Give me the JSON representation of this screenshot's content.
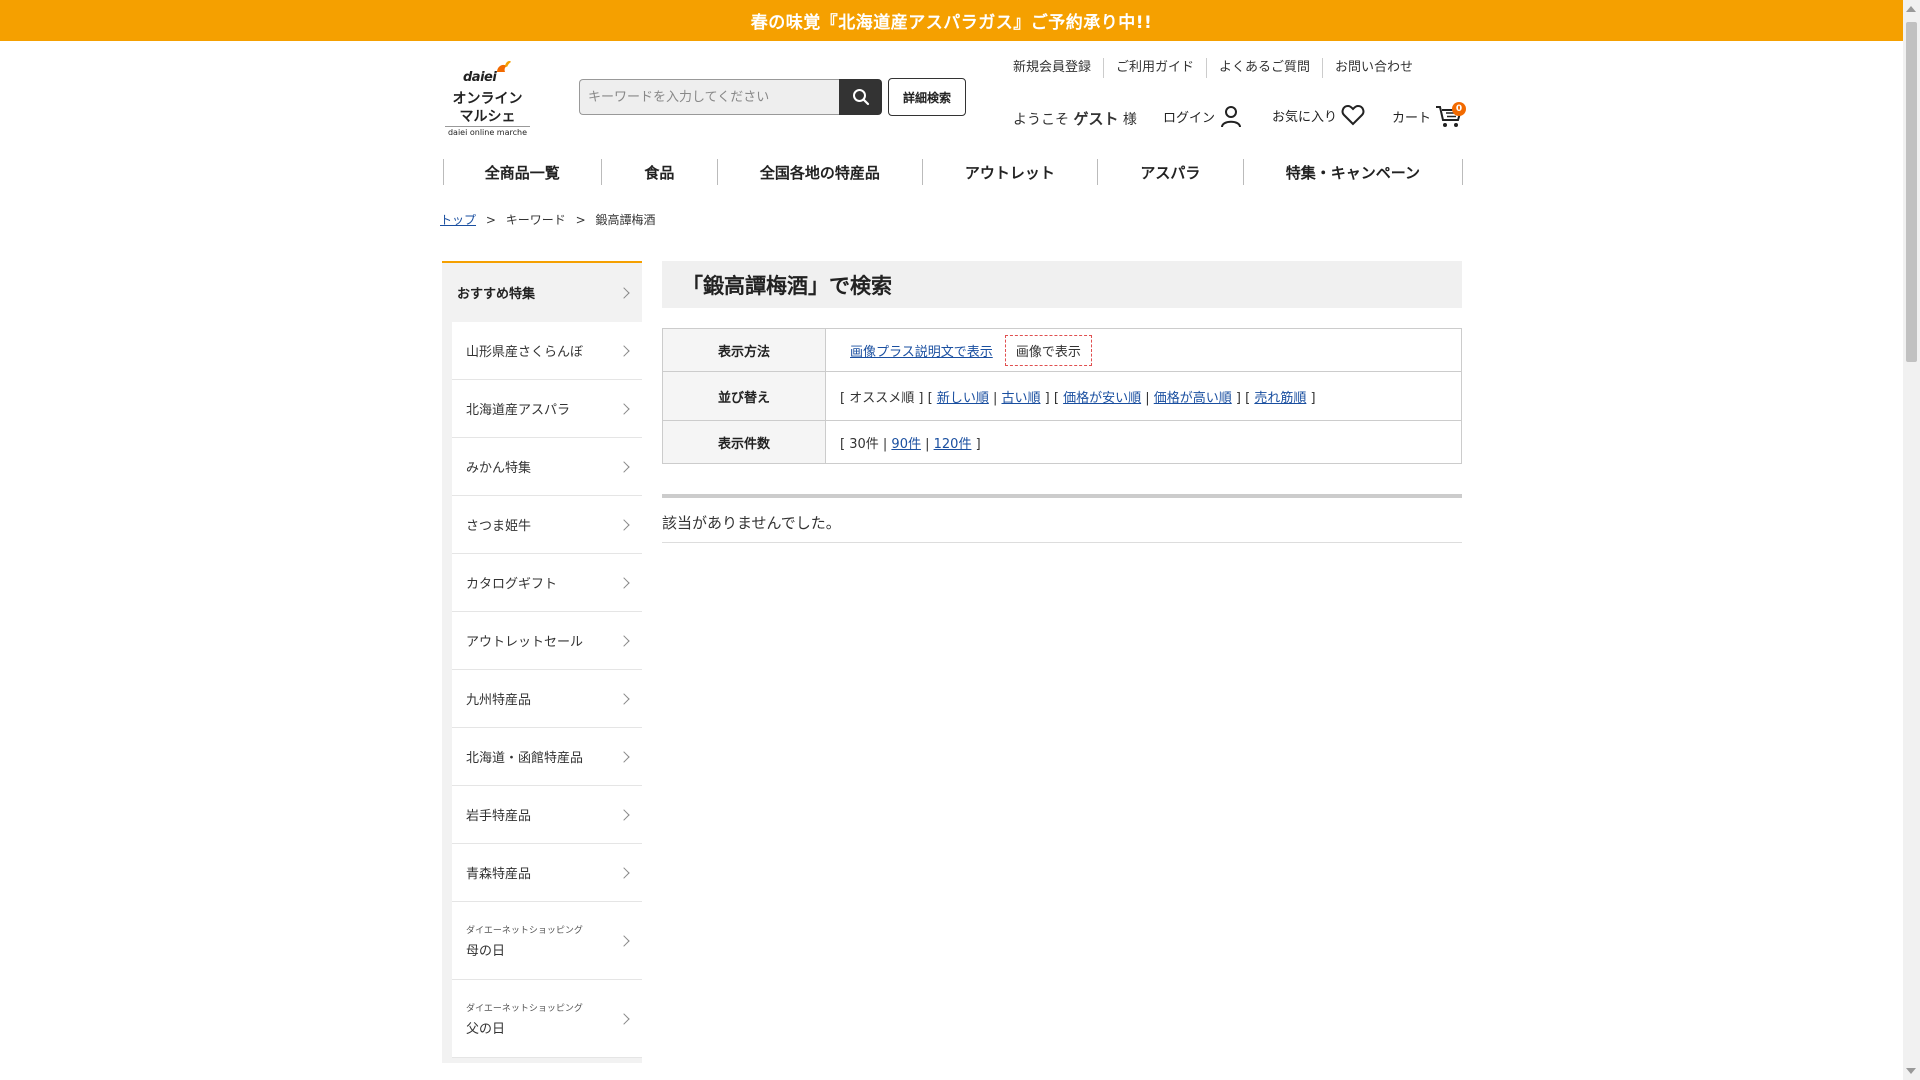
{
  "banner": {
    "text": "春の味覚『北海道産アスパラガス』ご予約承り中!!"
  },
  "logo": {
    "brand": "daiei",
    "line1": "オンライン",
    "line2": "マルシェ",
    "line3": "daiei online marche"
  },
  "search": {
    "placeholder": "キーワードを入力してください",
    "button_icon": "search-icon",
    "advanced_label": "詳細検索"
  },
  "util_nav": [
    "新規会員登録",
    "ご利用ガイド",
    "よくあるご質問",
    "お問い合わせ"
  ],
  "user": {
    "welcome_prefix": "ようこそ",
    "name": "ゲスト",
    "suffix": "様"
  },
  "header_links": {
    "login": "ログイン",
    "favorites": "お気に入り",
    "cart": "カート",
    "cart_count": "0"
  },
  "main_nav": [
    "全商品一覧",
    "食品",
    "全国各地の特産品",
    "アウトレット",
    "アスパラ",
    "特集・キャンペーン"
  ],
  "breadcrumb": {
    "top": "トップ",
    "keyword": "キーワード",
    "current": "鍛高譚梅酒",
    "sep": ">"
  },
  "sidebar": {
    "heading": "おすすめ特集",
    "items": [
      {
        "sub": "",
        "label": "山形県産さくらんぼ"
      },
      {
        "sub": "",
        "label": "北海道産アスパラ"
      },
      {
        "sub": "",
        "label": "みかん特集"
      },
      {
        "sub": "",
        "label": "さつま姫牛"
      },
      {
        "sub": "",
        "label": "カタログギフト"
      },
      {
        "sub": "",
        "label": "アウトレットセール"
      },
      {
        "sub": "",
        "label": "九州特産品"
      },
      {
        "sub": "",
        "label": "北海道・函館特産品"
      },
      {
        "sub": "",
        "label": "岩手特産品"
      },
      {
        "sub": "",
        "label": "青森特産品"
      },
      {
        "sub": "ダイエーネットショッピング",
        "label": "母の日"
      },
      {
        "sub": "ダイエーネットショッピング",
        "label": "父の日"
      }
    ]
  },
  "page_title": "「鍛高譚梅酒」で検索",
  "options": {
    "display_method": {
      "label": "表示方法",
      "link": "画像プラス説明文で表示",
      "active": "画像で表示"
    },
    "sort": {
      "label": "並び替え",
      "open": "[",
      "current": "オススメ順",
      "close": "]",
      "links": [
        "新しい順",
        "古い順",
        "価格が安い順",
        "価格が高い順",
        "売れ筋順"
      ]
    },
    "count": {
      "label": "表示件数",
      "current": "30件",
      "links": [
        "90件",
        "120件"
      ]
    }
  },
  "no_result": "該当がありませんでした。"
}
